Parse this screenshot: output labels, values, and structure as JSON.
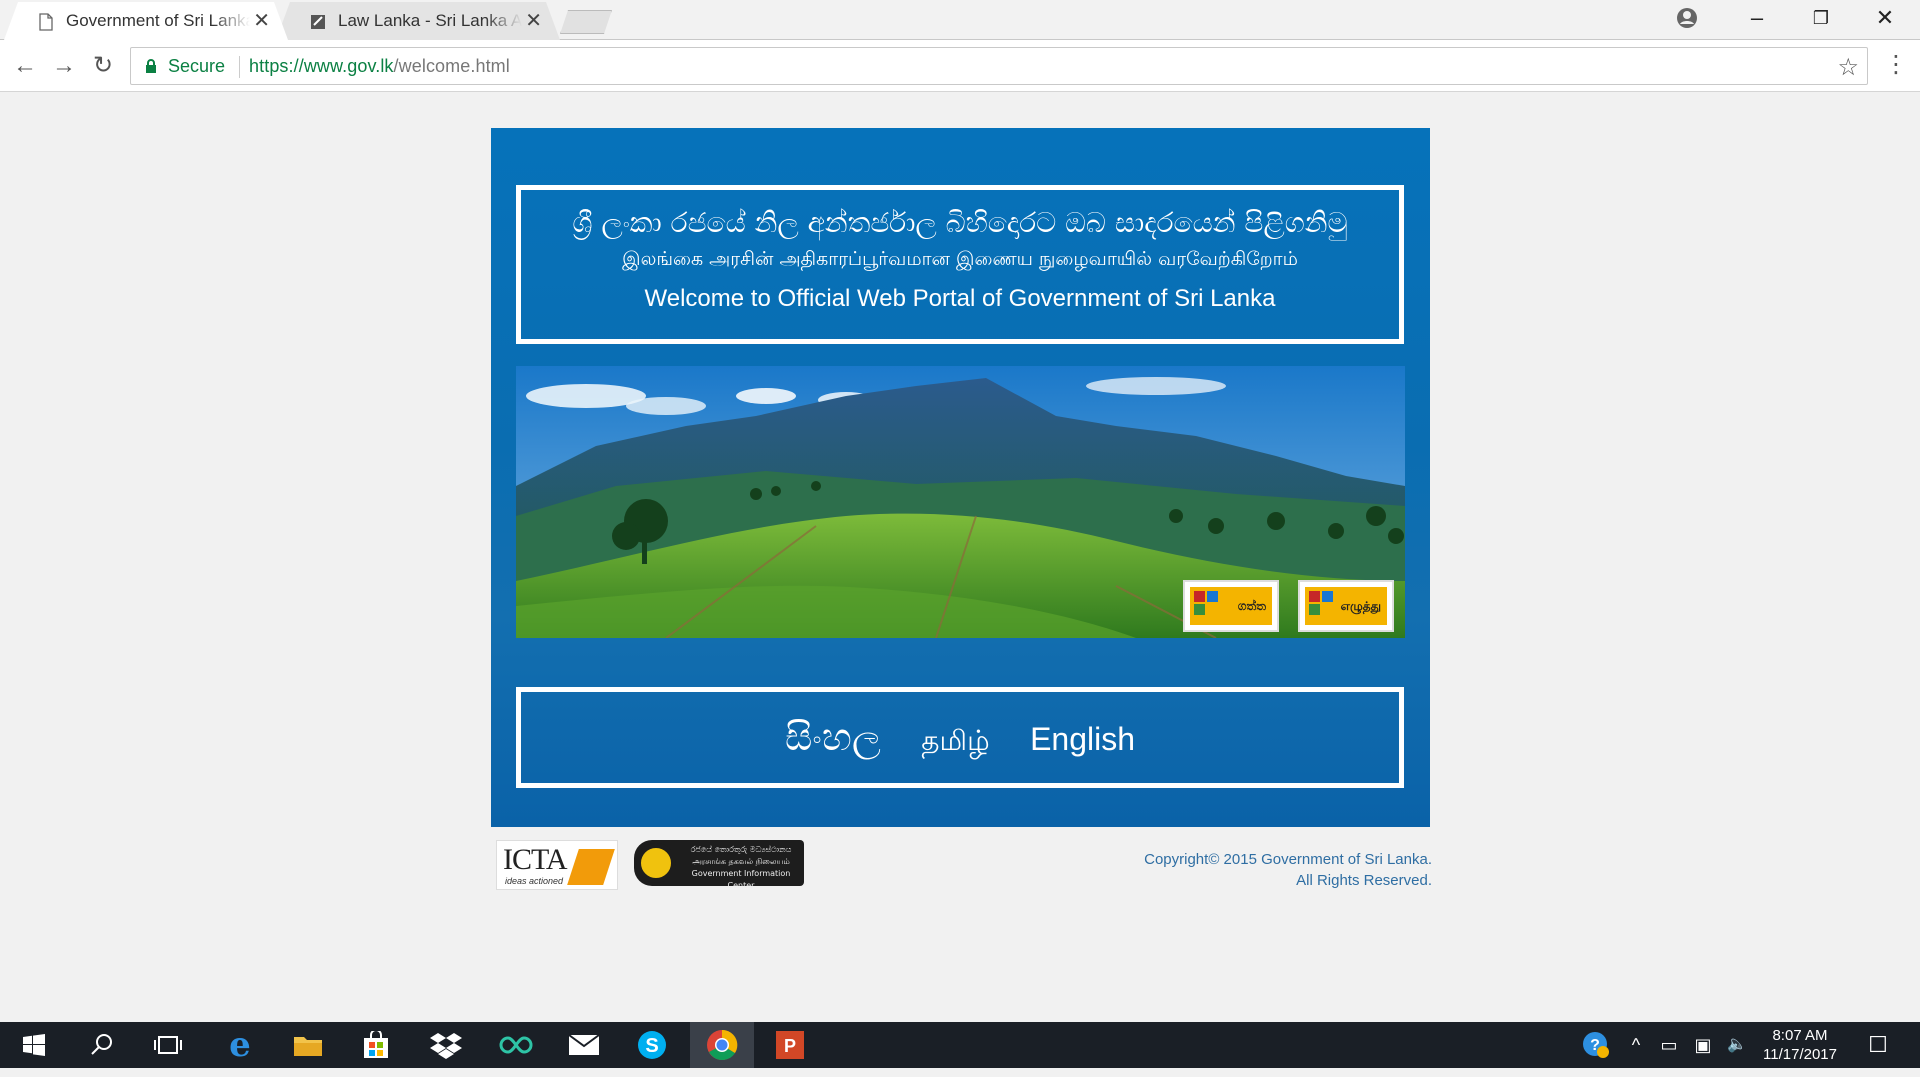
{
  "browser": {
    "tabs": [
      {
        "title": "Government of Sri Lanka",
        "close": "✕",
        "active": true
      },
      {
        "title": "Law Lanka - Sri Lanka Acts",
        "close": "✕",
        "active": false
      }
    ],
    "window_controls": {
      "minimize": "–",
      "restore": "❐",
      "close": "✕"
    },
    "toolbar": {
      "back": "←",
      "forward": "→",
      "reload": "↻",
      "menu": "⋮"
    },
    "address": {
      "secure_label": "Secure",
      "url_host": "https://www.gov.lk",
      "url_path": "/welcome.html",
      "bookmark": "☆"
    }
  },
  "page": {
    "welcome": {
      "sinhala": "ශ්‍රී ලංකා රජයේ නිල අන්තර්ජාල බිහිදොරට ඔබ සාදරයෙන් පිළිගනිමු",
      "tamil": "இலங்கை அரசின் அதிகாரப்பூர்வமான இணைய நுழைவாயில் வரவேற்கிறோம்",
      "english": "Welcome to Official Web Portal of Government of Sri Lanka"
    },
    "banner_buttons": [
      {
        "label": "ගත්ත"
      },
      {
        "label": "எழுத்து"
      }
    ],
    "languages": {
      "sinhala": "සිංහල",
      "tamil": "தமிழ்",
      "english": "English"
    },
    "footer": {
      "icta_logo": "ICTA",
      "icta_tagline": "ideas actioned",
      "gic_logo": "රජයේ තොරතුරු මධ්‍යස්ථානය அரசாங்க தகவல் நிலையம் Government Information Center",
      "copyright_line1": "Copyright© 2015 Government of Sri Lanka.",
      "copyright_line2": "All Rights Reserved."
    }
  },
  "taskbar": {
    "start": "⊞",
    "search": "⌕",
    "task_view": "❐",
    "apps": [
      "edge-icon",
      "file-explorer-icon",
      "store-icon",
      "dropbox-icon",
      "infinity-icon",
      "mail-icon",
      "skype-icon",
      "chrome-icon",
      "powerpoint-icon"
    ],
    "tray": {
      "up": "^",
      "battery": "▭",
      "network": "▣",
      "volume": "🔈"
    },
    "time": "8:07 AM",
    "date": "11/17/2017",
    "notifications": "☐"
  },
  "colors": {
    "portal_blue": "#0672ba",
    "secure_green": "#0b8043",
    "copyright_blue": "#2f6ea3"
  }
}
